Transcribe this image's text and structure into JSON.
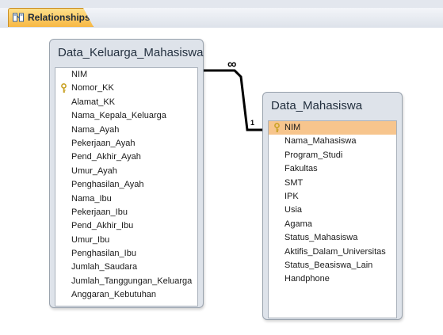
{
  "tab": {
    "label": "Relationships"
  },
  "tables": {
    "left": {
      "title": "Data_Keluarga_Mahasiswa",
      "fields": [
        {
          "name": "NIM",
          "key": false
        },
        {
          "name": "Nomor_KK",
          "key": true
        },
        {
          "name": "Alamat_KK",
          "key": false
        },
        {
          "name": "Nama_Kepala_Keluarga",
          "key": false
        },
        {
          "name": "Nama_Ayah",
          "key": false
        },
        {
          "name": "Pekerjaan_Ayah",
          "key": false
        },
        {
          "name": "Pend_Akhir_Ayah",
          "key": false
        },
        {
          "name": "Umur_Ayah",
          "key": false
        },
        {
          "name": "Penghasilan_Ayah",
          "key": false
        },
        {
          "name": "Nama_Ibu",
          "key": false
        },
        {
          "name": "Pekerjaan_Ibu",
          "key": false
        },
        {
          "name": "Pend_Akhir_Ibu",
          "key": false
        },
        {
          "name": "Umur_Ibu",
          "key": false
        },
        {
          "name": "Penghasilan_Ibu",
          "key": false
        },
        {
          "name": "Jumlah_Saudara",
          "key": false
        },
        {
          "name": "Jumlah_Tanggungan_Keluarga",
          "key": false
        },
        {
          "name": "Anggaran_Kebutuhan",
          "key": false
        }
      ]
    },
    "right": {
      "title": "Data_Mahasiswa",
      "fields": [
        {
          "name": "NIM",
          "key": true,
          "selected": true
        },
        {
          "name": "Nama_Mahasiswa",
          "key": false
        },
        {
          "name": "Program_Studi",
          "key": false
        },
        {
          "name": "Fakultas",
          "key": false
        },
        {
          "name": "SMT",
          "key": false
        },
        {
          "name": "IPK",
          "key": false
        },
        {
          "name": "Usia",
          "key": false
        },
        {
          "name": "Agama",
          "key": false
        },
        {
          "name": "Status_Mahasiswa",
          "key": false
        },
        {
          "name": "Aktifis_Dalam_Universitas",
          "key": false
        },
        {
          "name": "Status_Beasiswa_Lain",
          "key": false
        },
        {
          "name": "Handphone",
          "key": false
        }
      ]
    }
  },
  "relationship": {
    "many_label": "∞",
    "one_label": "1"
  },
  "colors": {
    "selected_row": "#f7c58d",
    "tab_accent": "#f7b743",
    "key_icon": "#c9a227"
  }
}
